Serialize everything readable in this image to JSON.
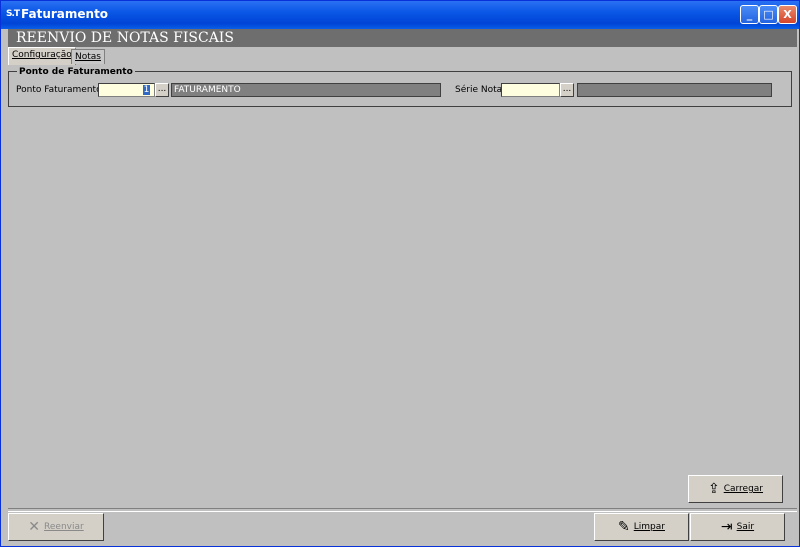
{
  "window": {
    "icon_text": "S.T",
    "title": "Faturamento",
    "controls": [
      "_",
      "□",
      "X"
    ]
  },
  "header": {
    "title": "REENVIO DE NOTAS FISCAIS"
  },
  "tabs": [
    {
      "label": "Configuração",
      "active": true
    },
    {
      "label": "Notas",
      "active": false
    }
  ],
  "group": {
    "title": "Ponto de Faturamento",
    "ponto_label": "Ponto Faturamento",
    "ponto_value": "1",
    "ponto_desc": "FATURAMENTO",
    "serie_label": "Série Nota",
    "serie_value": "",
    "serie_desc": "",
    "ellipsis": "..."
  },
  "buttons": {
    "carregar": "Carregar",
    "reenviar": "Reenviar",
    "limpar": "Limpar",
    "sair": "Sair"
  },
  "colors": {
    "titlebar": "#0a57e6",
    "header_bg": "#6e6e6e",
    "field_bg": "#ffffe0"
  }
}
